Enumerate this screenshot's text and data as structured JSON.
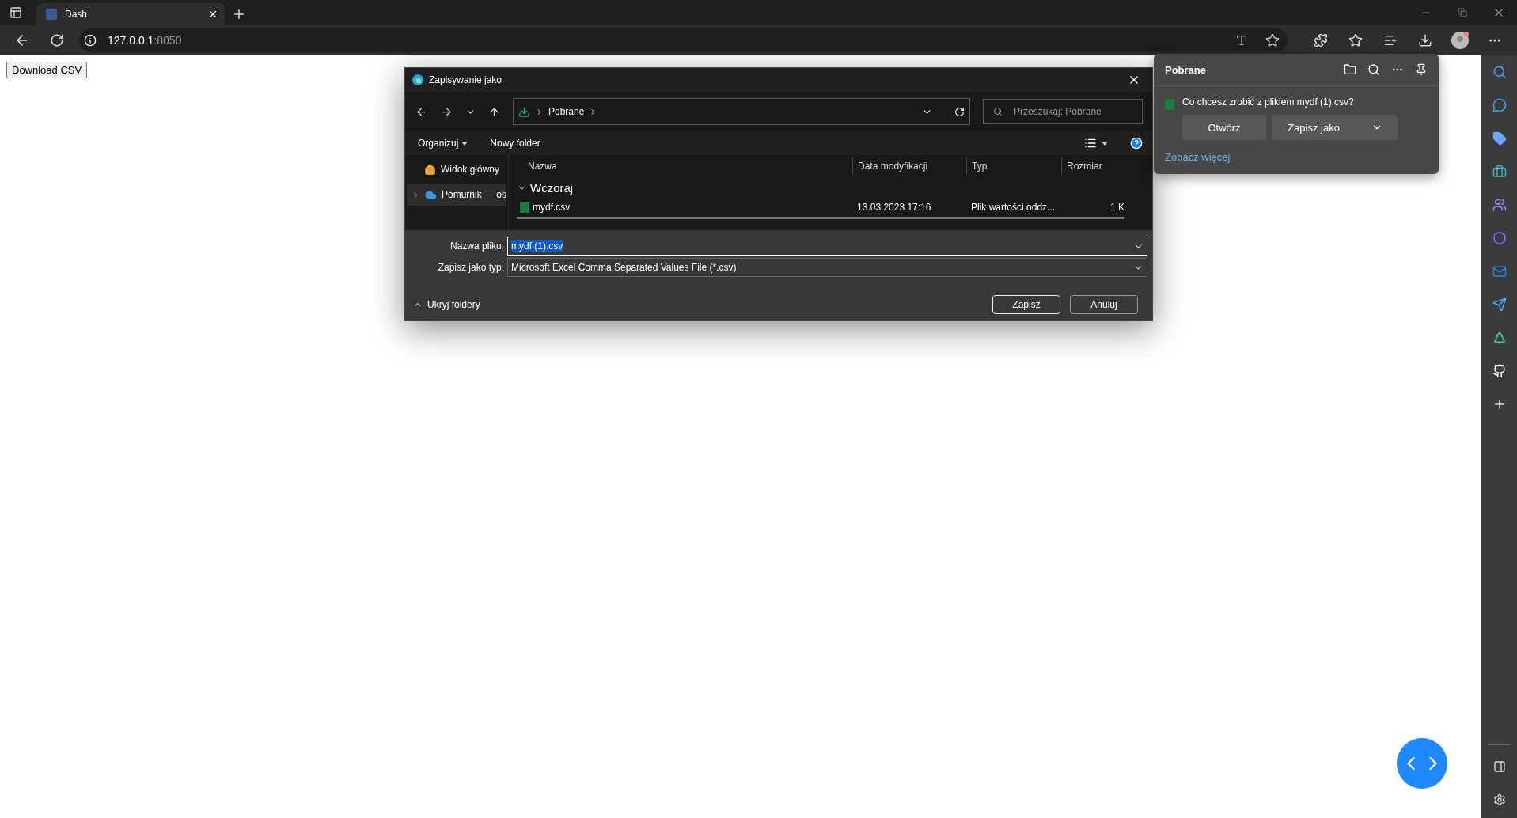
{
  "browser": {
    "tabs": [
      {
        "title": "Dash",
        "selected": true
      }
    ],
    "address": {
      "host": "127.0.0.1",
      "port": ":8050"
    }
  },
  "page": {
    "button": "Download CSV"
  },
  "dialog": {
    "title": "Zapisywanie jako",
    "breadcrumb": [
      "Pobrane"
    ],
    "search": {
      "placeholder": "Przeszukaj: Pobrane"
    },
    "toolbar": [
      "Organizuj",
      "Nowy folder"
    ],
    "nav": [
      {
        "label": "Widok główny",
        "kind": "home",
        "selected": false
      },
      {
        "label": "Pomurnik — os",
        "kind": "cloud",
        "selected": true
      }
    ],
    "columns": [
      "Nazwa",
      "Data modyfikacji",
      "Typ",
      "Rozmiar"
    ],
    "groups": [
      {
        "label": "Wczoraj",
        "expanded": true,
        "files": [
          {
            "name": "mydf.csv",
            "modified": "13.03.2023 17:16",
            "type": "Plik wartości oddz...",
            "size": "1 K"
          }
        ]
      }
    ],
    "fields": [
      {
        "label": "Nazwa pliku:",
        "value": "mydf (1).csv",
        "focused": true
      },
      {
        "label": "Zapisz jako typ:",
        "value": "Microsoft Excel Comma Separated Values File (*.csv)",
        "focused": false
      }
    ],
    "hide_folders": "Ukryj foldery",
    "buttons": [
      {
        "label": "Zapisz",
        "default": true
      },
      {
        "label": "Anuluj",
        "default": false
      }
    ]
  },
  "downloads": {
    "title": "Pobrane",
    "prompt": "Co chcesz zrobić z plikiem mydf (1).csv?",
    "actions": [
      "Otwórz",
      "Zapisz jako"
    ],
    "more_link": "Zobacz więcej"
  }
}
